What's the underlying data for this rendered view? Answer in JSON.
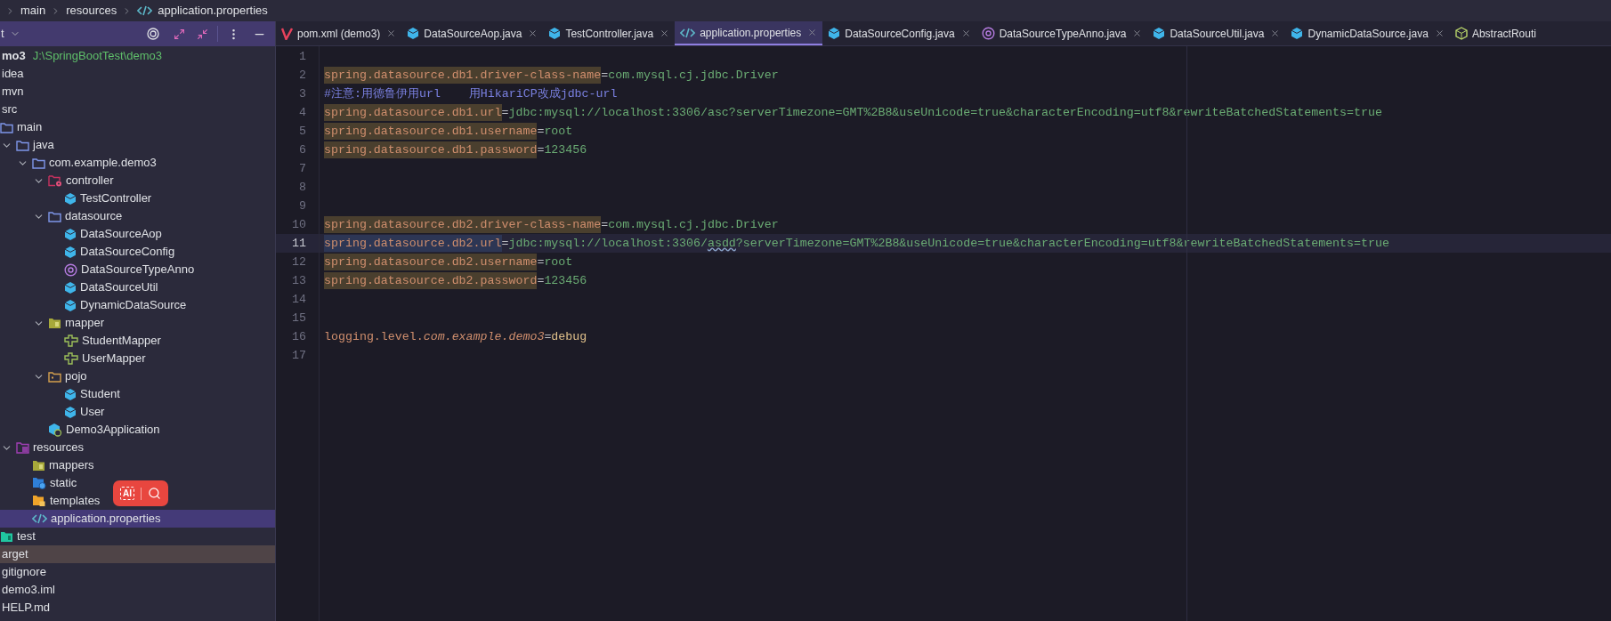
{
  "breadcrumb": [
    {
      "label": "main"
    },
    {
      "label": "resources"
    },
    {
      "label": "application.properties",
      "kind": "props"
    }
  ],
  "sidebar": {
    "title": "t",
    "tree": [
      {
        "label": "mo3",
        "path": "J:\\SpringBootTest\\demo3",
        "selected": false,
        "excluded": false,
        "children": [
          {
            "label": "idea",
            "selected": false,
            "excluded": false
          },
          {
            "label": "mvn",
            "selected": false,
            "excluded": false
          },
          {
            "label": "src",
            "selected": false,
            "excluded": false,
            "children": [
              {
                "label": "main",
                "kind": "folder",
                "selected": false,
                "excluded": false,
                "children": [
                  {
                    "label": "java",
                    "kind": "folder",
                    "expanded": true,
                    "selected": false,
                    "excluded": false,
                    "children": [
                      {
                        "label": "com.example.demo3",
                        "kind": "folder",
                        "expanded": true,
                        "selected": false,
                        "excluded": false,
                        "children": [
                          {
                            "label": "controller",
                            "kind": "controller-folder",
                            "expanded": true,
                            "selected": false,
                            "excluded": false,
                            "children": [
                              {
                                "label": "TestController",
                                "kind": "class",
                                "selected": false,
                                "excluded": false
                              }
                            ]
                          },
                          {
                            "label": "datasource",
                            "kind": "folder",
                            "expanded": true,
                            "selected": false,
                            "excluded": false,
                            "children": [
                              {
                                "label": "DataSourceAop",
                                "kind": "class",
                                "selected": false,
                                "excluded": false
                              },
                              {
                                "label": "DataSourceConfig",
                                "kind": "class",
                                "selected": false,
                                "excluded": false
                              },
                              {
                                "label": "DataSourceTypeAnno",
                                "kind": "annotation",
                                "selected": false,
                                "excluded": false
                              },
                              {
                                "label": "DataSourceUtil",
                                "kind": "class",
                                "selected": false,
                                "excluded": false
                              },
                              {
                                "label": "DynamicDataSource",
                                "kind": "class",
                                "selected": false,
                                "excluded": false
                              }
                            ]
                          },
                          {
                            "label": "mapper",
                            "kind": "mapper-folder",
                            "expanded": true,
                            "selected": false,
                            "excluded": false,
                            "children": [
                              {
                                "label": "StudentMapper",
                                "kind": "mapper",
                                "selected": false,
                                "excluded": false
                              },
                              {
                                "label": "UserMapper",
                                "kind": "mapper",
                                "selected": false,
                                "excluded": false
                              }
                            ]
                          },
                          {
                            "label": "pojo",
                            "kind": "pojo-folder",
                            "expanded": true,
                            "selected": false,
                            "excluded": false,
                            "children": [
                              {
                                "label": "Student",
                                "kind": "class",
                                "selected": false,
                                "excluded": false
                              },
                              {
                                "label": "User",
                                "kind": "class",
                                "selected": false,
                                "excluded": false
                              }
                            ]
                          },
                          {
                            "label": "Demo3Application",
                            "kind": "app",
                            "selected": false,
                            "excluded": false
                          }
                        ]
                      }
                    ]
                  },
                  {
                    "label": "resources",
                    "kind": "resources-folder",
                    "expanded": true,
                    "selected": false,
                    "excluded": false,
                    "children": [
                      {
                        "label": "mappers",
                        "kind": "mapper-folder",
                        "selected": false,
                        "excluded": false
                      },
                      {
                        "label": "static",
                        "kind": "static-folder",
                        "selected": false,
                        "excluded": false
                      },
                      {
                        "label": "templates",
                        "kind": "templates-folder",
                        "selected": false,
                        "excluded": false
                      },
                      {
                        "label": "application.properties",
                        "kind": "props",
                        "selected": true,
                        "excluded": false
                      }
                    ]
                  }
                ]
              },
              {
                "label": "test",
                "kind": "test-folder",
                "selected": false,
                "excluded": false
              }
            ]
          },
          {
            "label": "arget",
            "selected": false,
            "excluded": true
          },
          {
            "label": "gitignore",
            "selected": false,
            "excluded": false
          },
          {
            "label": "demo3.iml",
            "selected": false,
            "excluded": false
          },
          {
            "label": "HELP.md",
            "selected": false,
            "excluded": false
          }
        ]
      }
    ]
  },
  "overlay": {
    "label": "AI"
  },
  "tabs": [
    {
      "label": "pom.xml (demo3)",
      "kind": "maven",
      "selected": false,
      "closable": true
    },
    {
      "label": "DataSourceAop.java",
      "kind": "class",
      "selected": false,
      "closable": true
    },
    {
      "label": "TestController.java",
      "kind": "class",
      "selected": false,
      "closable": true
    },
    {
      "label": "application.properties",
      "kind": "props",
      "selected": true,
      "closable": true
    },
    {
      "label": "DataSourceConfig.java",
      "kind": "class",
      "selected": false,
      "closable": true
    },
    {
      "label": "DataSourceTypeAnno.java",
      "kind": "annotation",
      "selected": false,
      "closable": true
    },
    {
      "label": "DataSourceUtil.java",
      "kind": "class",
      "selected": false,
      "closable": true
    },
    {
      "label": "DynamicDataSource.java",
      "kind": "class",
      "selected": false,
      "closable": true
    },
    {
      "label": "AbstractRouti",
      "kind": "abstract",
      "selected": false,
      "closable": false
    }
  ],
  "editor": {
    "lines": [
      {
        "number": "1",
        "current": false
      },
      {
        "number": "2",
        "current": false,
        "segments": [
          {
            "kind": "key",
            "text": "spring.datasource.db1.driver-class-name",
            "highlight": true
          },
          {
            "kind": "eq",
            "text": "="
          },
          {
            "kind": "value",
            "text": "com.mysql.cj.jdbc.Driver"
          }
        ]
      },
      {
        "number": "3",
        "current": false,
        "segments": [
          {
            "kind": "comment",
            "text": "#注意:用德鲁伊用url    用HikariCP改成jdbc-url"
          }
        ]
      },
      {
        "number": "4",
        "current": false,
        "segments": [
          {
            "kind": "key",
            "text": "spring.datasource.db1.url",
            "highlight": true
          },
          {
            "kind": "eq",
            "text": "="
          },
          {
            "kind": "value",
            "text": "jdbc:mysql://localhost:3306/asc?serverTimezone=GMT%2B8&useUnicode=true&characterEncoding=utf8&rewriteBatchedStatements=true"
          }
        ]
      },
      {
        "number": "5",
        "current": false,
        "segments": [
          {
            "kind": "key",
            "text": "spring.datasource.db1.username",
            "highlight": true
          },
          {
            "kind": "eq",
            "text": "="
          },
          {
            "kind": "value",
            "text": "root"
          }
        ]
      },
      {
        "number": "6",
        "current": false,
        "segments": [
          {
            "kind": "key",
            "text": "spring.datasource.db1.password",
            "highlight": true
          },
          {
            "kind": "eq",
            "text": "="
          },
          {
            "kind": "value",
            "text": "123456"
          }
        ]
      },
      {
        "number": "7",
        "current": false
      },
      {
        "number": "8",
        "current": false
      },
      {
        "number": "9",
        "current": false
      },
      {
        "number": "10",
        "current": false,
        "segments": [
          {
            "kind": "key",
            "text": "spring.datasource.db2.driver-class-name",
            "highlight": true
          },
          {
            "kind": "eq",
            "text": "="
          },
          {
            "kind": "value",
            "text": "com.mysql.cj.jdbc.Driver"
          }
        ]
      },
      {
        "number": "11",
        "current": true,
        "segments": [
          {
            "kind": "key",
            "text": "spring.datasource.db2.url",
            "highlight": false
          },
          {
            "kind": "eq",
            "text": "="
          },
          {
            "kind": "value",
            "text": "jdbc:mysql://localhost:3306/"
          },
          {
            "kind": "typo",
            "text": "asdd"
          },
          {
            "kind": "value",
            "text": "?serverTimezone=GMT%2B8&useUnicode=true&characterEncoding=utf8&rewriteBatchedStatements=true"
          }
        ]
      },
      {
        "number": "12",
        "current": false,
        "segments": [
          {
            "kind": "key",
            "text": "spring.datasource.db2.username",
            "highlight": true
          },
          {
            "kind": "eq",
            "text": "="
          },
          {
            "kind": "value",
            "text": "root"
          }
        ]
      },
      {
        "number": "13",
        "current": false,
        "segments": [
          {
            "kind": "key",
            "text": "spring.datasource.db2.password",
            "highlight": true
          },
          {
            "kind": "eq",
            "text": "="
          },
          {
            "kind": "value",
            "text": "123456"
          }
        ]
      },
      {
        "number": "14",
        "current": false
      },
      {
        "number": "15",
        "current": false
      },
      {
        "number": "16",
        "current": false,
        "segments": [
          {
            "kind": "key",
            "text": "logging.level.",
            "highlight": false
          },
          {
            "kind": "key-italic",
            "text": "com.example.demo3",
            "highlight": false
          },
          {
            "kind": "eq",
            "text": "="
          },
          {
            "kind": "enum",
            "text": "debug"
          }
        ]
      },
      {
        "number": "17",
        "current": false
      }
    ]
  }
}
